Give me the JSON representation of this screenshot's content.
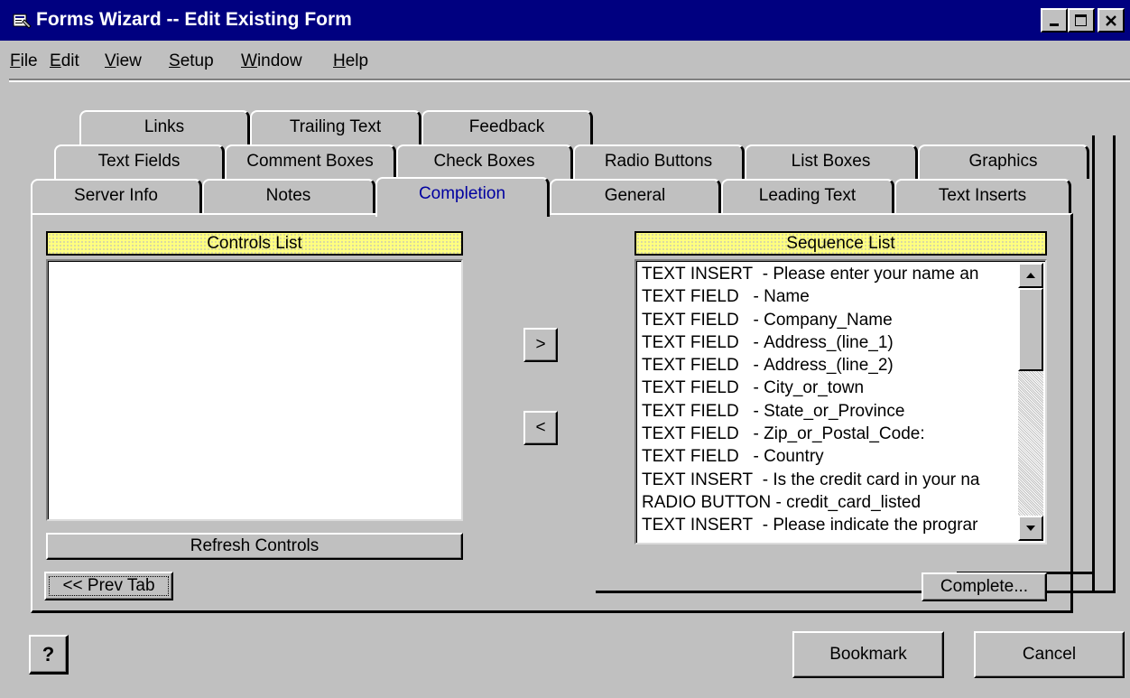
{
  "window": {
    "title": "Forms Wizard -- Edit Existing Form",
    "controls": [
      "minimize-icon",
      "maximize-icon",
      "close-icon"
    ]
  },
  "menu": [
    {
      "label": "File",
      "mnemonic": "F"
    },
    {
      "label": "Edit",
      "mnemonic": "E"
    },
    {
      "label": "View",
      "mnemonic": "V"
    },
    {
      "label": "Setup",
      "mnemonic": "S"
    },
    {
      "label": "Window",
      "mnemonic": "W"
    },
    {
      "label": "Help",
      "mnemonic": "H"
    }
  ],
  "tabs": {
    "row1": [
      "Links",
      "Trailing Text",
      "Feedback"
    ],
    "row2": [
      "Text Fields",
      "Comment Boxes",
      "Check Boxes",
      "Radio Buttons",
      "List Boxes",
      "Graphics"
    ],
    "row3": [
      "Server Info",
      "Notes",
      "Completion",
      "General",
      "Leading Text",
      "Text Inserts"
    ],
    "active": "Completion"
  },
  "controls_list": {
    "header": "Controls List",
    "items": []
  },
  "sequence_list": {
    "header": "Sequence List",
    "items": [
      "TEXT INSERT  - Please enter your name an",
      "TEXT FIELD   - Name",
      "TEXT FIELD   - Company_Name",
      "TEXT FIELD   - Address_(line_1)",
      "TEXT FIELD   - Address_(line_2)",
      "TEXT FIELD   - City_or_town",
      "TEXT FIELD   - State_or_Province",
      "TEXT FIELD   - Zip_or_Postal_Code:",
      "TEXT FIELD   - Country",
      "TEXT INSERT  - Is the credit card in your na",
      "RADIO BUTTON - credit_card_listed",
      "TEXT INSERT  - Please indicate the prograr"
    ]
  },
  "buttons": {
    "move_right": ">",
    "move_left": "<",
    "refresh": "Refresh Controls",
    "prev_tab": "<< Prev Tab",
    "complete": "Complete...",
    "help": "?",
    "bookmark": "Bookmark",
    "cancel": "Cancel"
  },
  "colors": {
    "title_bar": "#000080",
    "face": "#c0c0c0",
    "list_header": "#ffff80",
    "active_tab_text": "#0000a0"
  }
}
